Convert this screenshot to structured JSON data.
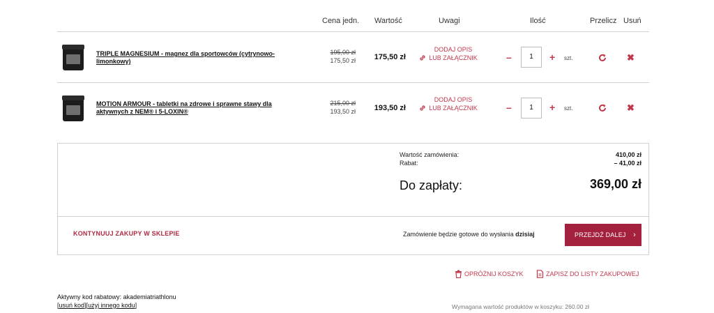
{
  "table_header": {
    "unit_price": "Cena jedn.",
    "value": "Wartość",
    "notes": "Uwagi",
    "quantity": "Ilość",
    "recalc": "Przelicz",
    "remove": "Usuń"
  },
  "items": [
    {
      "name": "TRIPLE MAGNESIUM - magnez dla sportowców (cytrynowo-limonkowy)",
      "old_price": "195,00 zł",
      "unit_price": "175,50 zł",
      "value": "175,50 zł",
      "note_link": "DODAJ OPIS LUB ZAŁĄCZNIK",
      "quantity": "1",
      "unit": "szt."
    },
    {
      "name": "MOTION ARMOUR - tabletki na zdrowe i sprawne stawy dla aktywnych z NEM® i 5-LOXIN®",
      "old_price": "215,00 zł",
      "unit_price": "193,50 zł",
      "value": "193,50 zł",
      "note_link": "DODAJ OPIS LUB ZAŁĄCZNIK",
      "quantity": "1",
      "unit": "szt."
    }
  ],
  "controls": {
    "minus": "–",
    "plus": "+",
    "remove": "✖"
  },
  "summary": {
    "order_value_label": "Wartość zamówienia:",
    "order_value": "410,00 zł",
    "discount_label": "Rabat:",
    "discount": "– 41,00 zł",
    "to_pay_label": "Do zapłaty:",
    "to_pay": "369,00 zł"
  },
  "checkout": {
    "continue_label": "KONTYNUUJ ZAKUPY W SKLEPIE",
    "ready_text": "Zamówienie będzie gotowe do wysłania",
    "ready_when": "dzisiaj",
    "next_label": "PRZEJDŹ DALEJ",
    "next_chevron": "›"
  },
  "actions": {
    "empty_cart": "OPRÓŻNIJ KOSZYK",
    "save_list": "ZAPISZ DO LISTY ZAKUPOWEJ"
  },
  "discount_code": {
    "active_label": "Aktywny kod rabatowy:",
    "code": "akademiatriathlonu",
    "remove_link": "usuń kod",
    "other_link": "użyj innego kodu"
  },
  "required_value_text": "Wymagana wartość produktów w koszyku: 260.00 zł",
  "colors": {
    "accent": "#c2384b",
    "button": "#a3213c",
    "border": "#cfcfcf"
  },
  "icons": {
    "note": "link-icon",
    "recalc": "refresh-icon",
    "remove": "close-icon",
    "empty": "trash-icon",
    "save": "document-icon"
  }
}
